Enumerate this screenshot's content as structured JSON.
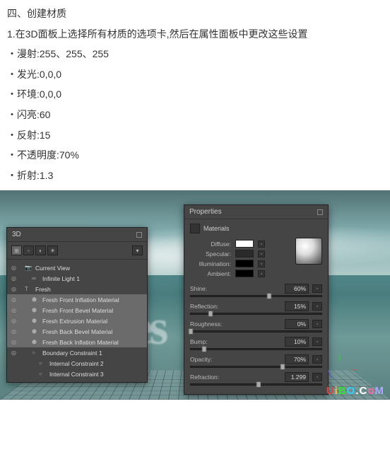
{
  "doc": {
    "heading": "四、创建材质",
    "step": "1.在3D面板上选择所有材质的选项卡,然后在属性面板中更改这些设置",
    "bullets": [
      "漫射:255、255、255",
      "发光:0,0,0",
      "环境:0,0,0",
      "闪亮:60",
      "反射:15",
      "不透明度:70%",
      "折射:1.3"
    ]
  },
  "panel3d": {
    "title": "3D",
    "items": [
      {
        "eye": "◎",
        "ind": 0,
        "ico": "📷",
        "label": "Current View",
        "sel": false
      },
      {
        "eye": "◎",
        "ind": 1,
        "ico": "∞",
        "label": "Infinite Light 1",
        "sel": false
      },
      {
        "eye": "◎",
        "ind": 0,
        "ico": "T",
        "label": "Fresh",
        "sel": false
      },
      {
        "eye": "◎",
        "ind": 1,
        "ico": "⬢",
        "label": "Fresh Front Inflation Material",
        "sel": true
      },
      {
        "eye": "◎",
        "ind": 1,
        "ico": "⬢",
        "label": "Fresh Front Bevel Material",
        "sel": true
      },
      {
        "eye": "◎",
        "ind": 1,
        "ico": "⬢",
        "label": "Fresh Extrusion Material",
        "sel": true
      },
      {
        "eye": "◎",
        "ind": 1,
        "ico": "⬢",
        "label": "Fresh Back Bevel Material",
        "sel": true
      },
      {
        "eye": "◎",
        "ind": 1,
        "ico": "⬢",
        "label": "Fresh Back Inflation Material",
        "sel": true
      },
      {
        "eye": "◎",
        "ind": 1,
        "ico": "○",
        "label": "Boundary Constraint 1",
        "sel": false
      },
      {
        "eye": "",
        "ind": 2,
        "ico": "○",
        "label": "Internal Constraint 2",
        "sel": false
      },
      {
        "eye": "",
        "ind": 2,
        "ico": "○",
        "label": "Internal Constraint 3",
        "sel": false
      }
    ]
  },
  "panelProps": {
    "title": "Properties",
    "section": "Materials",
    "colorRows": [
      {
        "label": "Diffuse:",
        "color": "#ffffff"
      },
      {
        "label": "Specular:",
        "color": "#2a2a2a"
      },
      {
        "label": "Illumination:",
        "color": "#000000"
      },
      {
        "label": "Ambient:",
        "color": "#000000"
      }
    ],
    "sliders": [
      {
        "label": "Shine:",
        "value": "60%",
        "pos": 60
      },
      {
        "label": "Reflection:",
        "value": "15%",
        "pos": 15
      },
      {
        "label": "Roughness:",
        "value": "0%",
        "pos": 0
      },
      {
        "label": "Bump:",
        "value": "10%",
        "pos": 10
      },
      {
        "label": "Opacity:",
        "value": "70%",
        "pos": 70
      },
      {
        "label": "Refraction:",
        "value": "1.299",
        "pos": 52
      }
    ]
  },
  "watermark": {
    "t1": "U",
    "t2": "i",
    "t3": "B",
    "t4": "O",
    "t5": ".C",
    "t6": "o",
    "t7": "M"
  }
}
